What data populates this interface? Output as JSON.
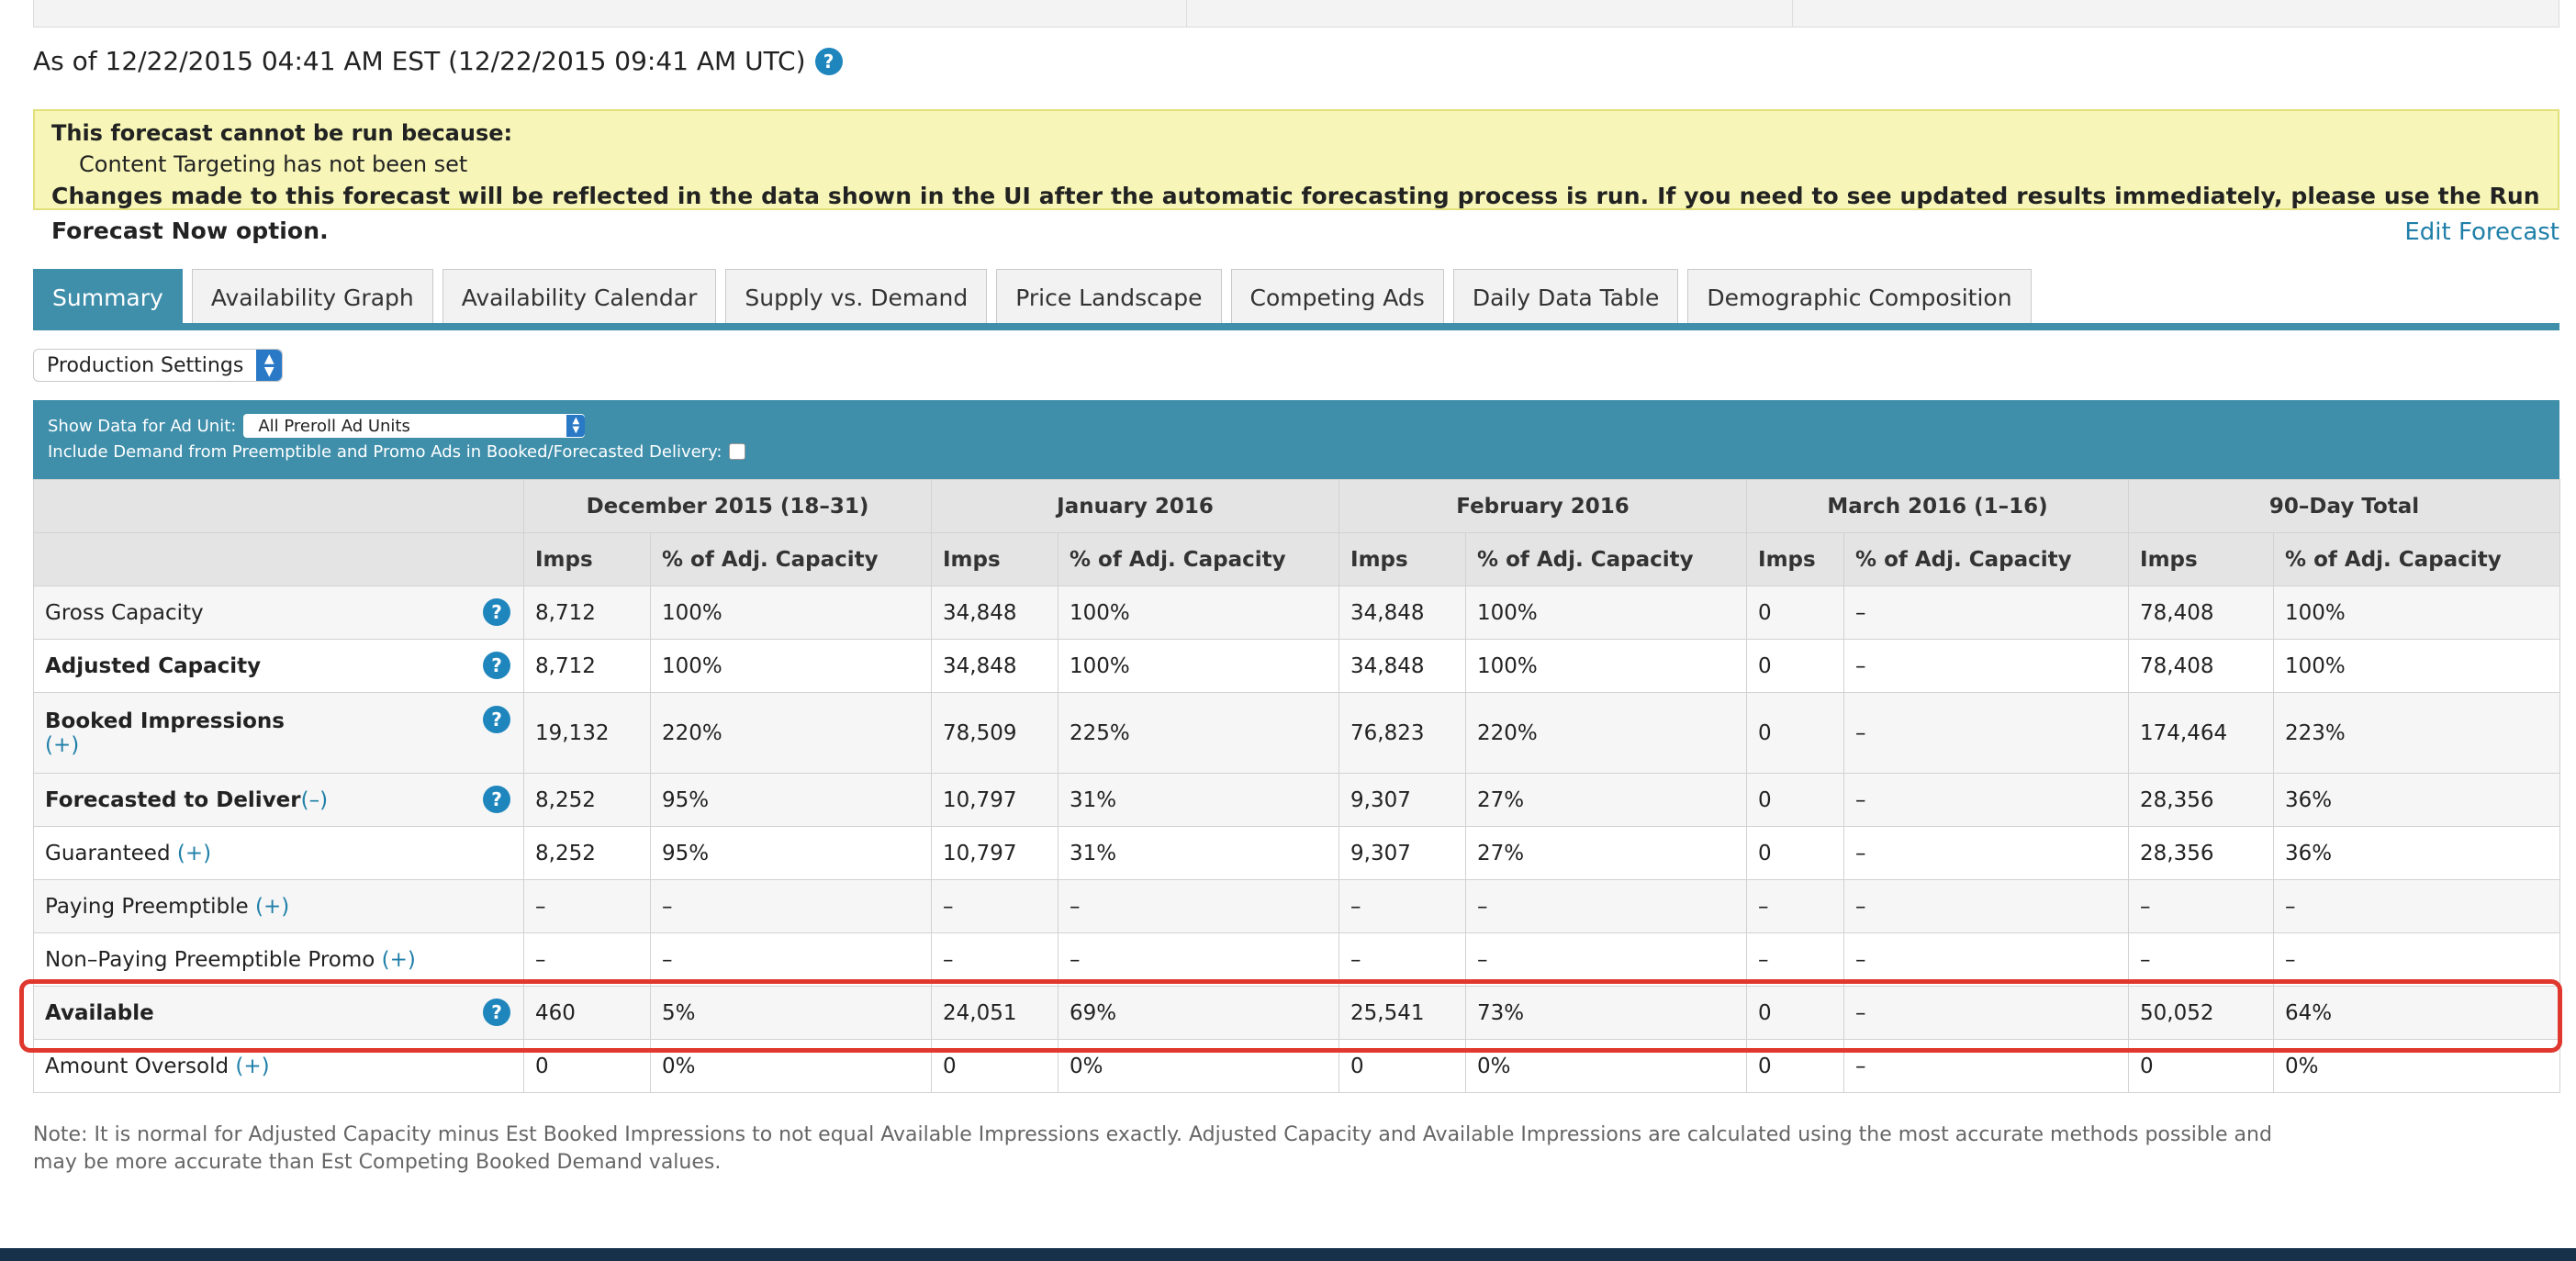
{
  "header": {
    "as_of": "As of 12/22/2015 04:41 AM EST (12/22/2015 09:41 AM UTC)"
  },
  "warning": {
    "title": "This forecast cannot be run because:",
    "reason": "Content Targeting has not been set",
    "note": "Changes made to this forecast will be reflected in the data shown in the UI after the automatic forecasting process is run. If you need to see updated results immediately, please use the Run Forecast Now option."
  },
  "edit_forecast_label": "Edit Forecast",
  "tabs": [
    "Summary",
    "Availability Graph",
    "Availability Calendar",
    "Supply vs. Demand",
    "Price Landscape",
    "Competing Ads",
    "Daily Data Table",
    "Demographic Composition"
  ],
  "settings_select": {
    "value": "Production Settings"
  },
  "filters": {
    "ad_unit_label": "Show Data for Ad Unit:",
    "ad_unit_value": "All Preroll Ad Units",
    "include_demand_label": "Include Demand from Preemptible and Promo Ads in Booked/Forecasted Delivery:"
  },
  "table": {
    "periods": [
      "December 2015 (18–31)",
      "January 2016",
      "February 2016",
      "March 2016 (1–16)",
      "90–Day Total"
    ],
    "sub_headers": {
      "imps": "Imps",
      "pct": "% of Adj. Capacity"
    },
    "rows": [
      {
        "label": "Gross Capacity",
        "suffix": "",
        "help": true,
        "values": [
          "8,712",
          "100%",
          "34,848",
          "100%",
          "34,848",
          "100%",
          "0",
          "–",
          "78,408",
          "100%"
        ]
      },
      {
        "label": "Adjusted Capacity",
        "suffix": "",
        "help": true,
        "values": [
          "8,712",
          "100%",
          "34,848",
          "100%",
          "34,848",
          "100%",
          "0",
          "–",
          "78,408",
          "100%"
        ]
      },
      {
        "label": "Booked Impressions",
        "suffix": "(+)",
        "help": true,
        "values": [
          "19,132",
          "220%",
          "78,509",
          "225%",
          "76,823",
          "220%",
          "0",
          "–",
          "174,464",
          "223%"
        ]
      },
      {
        "label": "Forecasted to Deliver",
        "suffix": "(–)",
        "help": true,
        "values": [
          "8,252",
          "95%",
          "10,797",
          "31%",
          "9,307",
          "27%",
          "0",
          "–",
          "28,356",
          "36%"
        ]
      },
      {
        "label": "Guaranteed",
        "suffix": "(+)",
        "help": false,
        "values": [
          "8,252",
          "95%",
          "10,797",
          "31%",
          "9,307",
          "27%",
          "0",
          "–",
          "28,356",
          "36%"
        ]
      },
      {
        "label": "Paying Preemptible",
        "suffix": "(+)",
        "help": false,
        "values": [
          "–",
          "–",
          "–",
          "–",
          "–",
          "–",
          "–",
          "–",
          "–",
          "–"
        ]
      },
      {
        "label": "Non–Paying Preemptible Promo",
        "suffix": "(+)",
        "help": false,
        "values": [
          "–",
          "–",
          "–",
          "–",
          "–",
          "–",
          "–",
          "–",
          "–",
          "–"
        ]
      },
      {
        "label": "Available",
        "suffix": "",
        "help": true,
        "values": [
          "460",
          "5%",
          "24,051",
          "69%",
          "25,541",
          "73%",
          "0",
          "–",
          "50,052",
          "64%"
        ]
      },
      {
        "label": "Amount Oversold",
        "suffix": "(+)",
        "help": false,
        "values": [
          "0",
          "0%",
          "0",
          "0%",
          "0",
          "0%",
          "0",
          "–",
          "0",
          "0%"
        ]
      }
    ]
  },
  "footnote": "Note: It is normal for Adjusted Capacity minus Est Booked Impressions to not equal Available Impressions exactly. Adjusted Capacity and Available Impressions are calculated using the most accurate methods possible and may be more accurate than Est Competing Booked Demand values.",
  "colors": {
    "accent": "#3f8fab",
    "help": "#1f86bd",
    "warning_bg": "#f7f6b8",
    "highlight": "#e0382e",
    "footer": "#17314a"
  }
}
